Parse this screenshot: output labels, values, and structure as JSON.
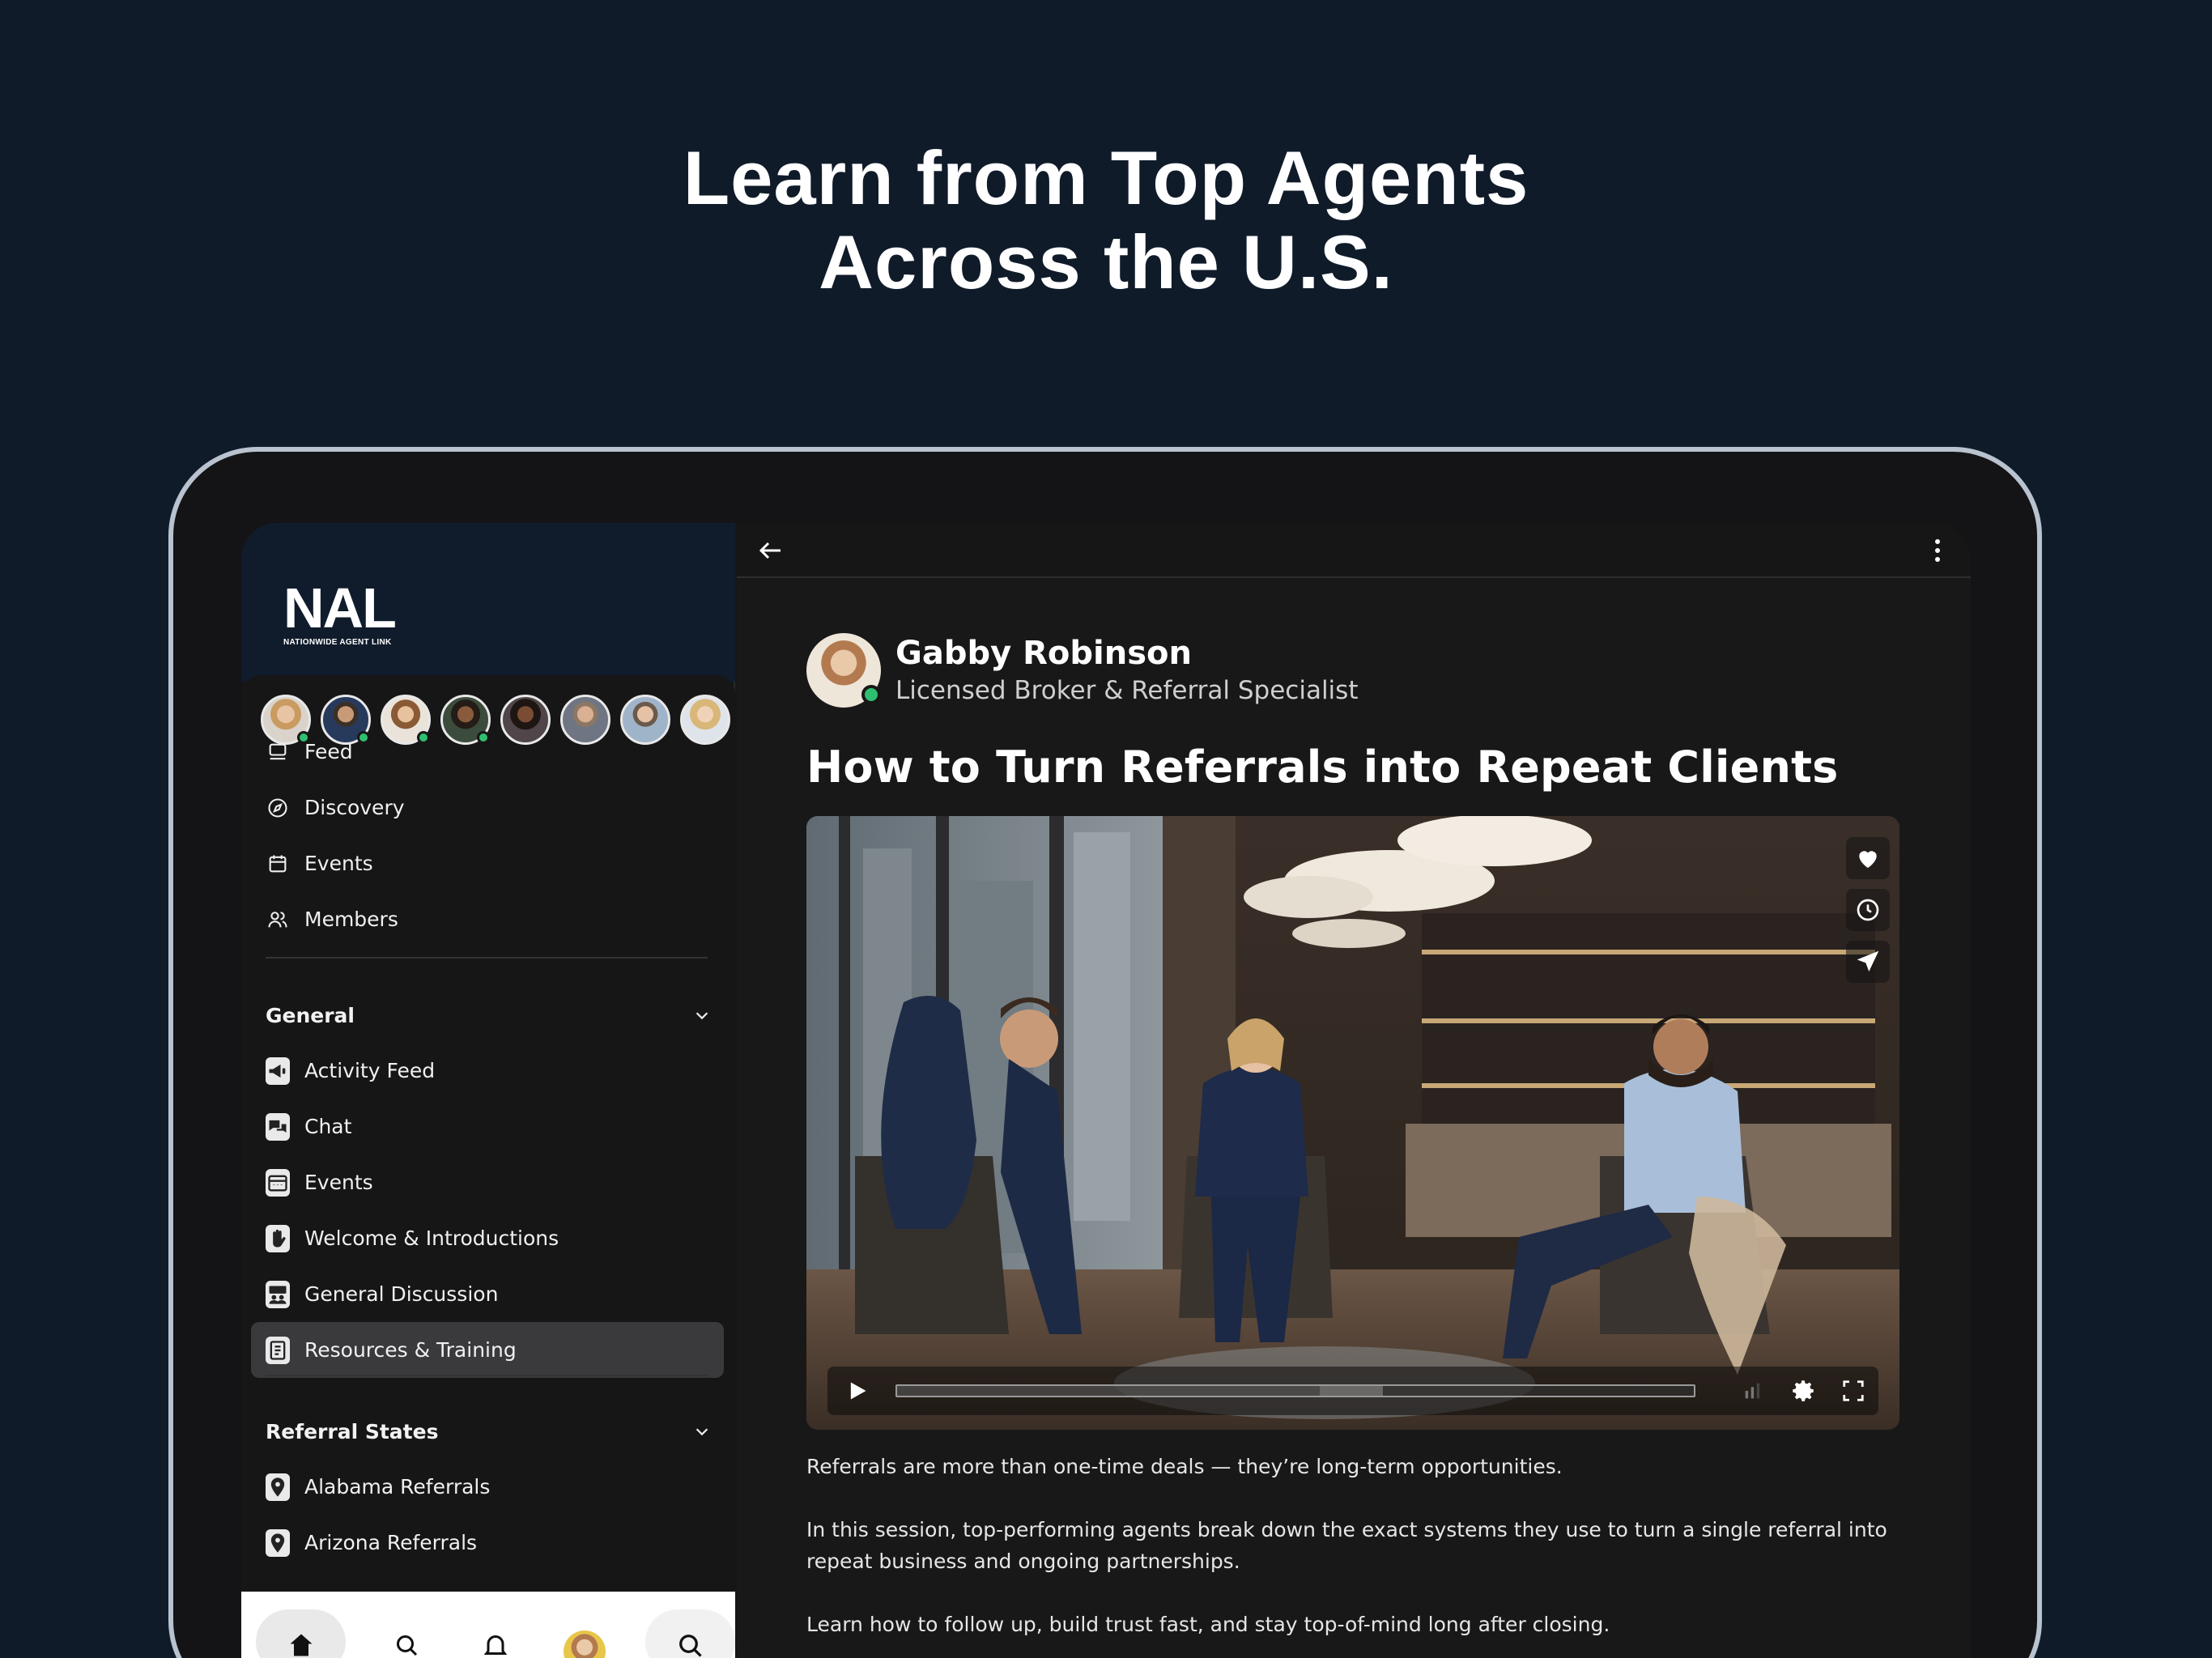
{
  "headline": {
    "line1": "Learn from Top Agents",
    "line2": "Across the U.S."
  },
  "brand": {
    "logo_text": "NAL",
    "logo_sub": "NATIONWIDE AGENT LINK"
  },
  "sidebar": {
    "primary_nav": [
      {
        "label": "Feed",
        "icon": "feed-icon"
      },
      {
        "label": "Discovery",
        "icon": "compass-icon"
      },
      {
        "label": "Events",
        "icon": "calendar-icon"
      },
      {
        "label": "Members",
        "icon": "members-icon"
      }
    ],
    "general": {
      "title": "General",
      "items": [
        {
          "label": "Activity Feed",
          "icon": "megaphone-icon"
        },
        {
          "label": "Chat",
          "icon": "chat-bubbles-icon"
        },
        {
          "label": "Events",
          "icon": "calendar-grid-icon"
        },
        {
          "label": "Welcome & Introductions",
          "icon": "waving-hand-icon"
        },
        {
          "label": "General Discussion",
          "icon": "people-board-icon"
        },
        {
          "label": "Resources & Training",
          "icon": "book-icon",
          "active": true
        }
      ]
    },
    "referral_states": {
      "title": "Referral States",
      "items": [
        {
          "label": "Alabama Referrals",
          "icon": "map-pin-icon"
        },
        {
          "label": "Arizona Referrals",
          "icon": "map-pin-icon"
        }
      ]
    }
  },
  "post": {
    "author_name": "Gabby Robinson",
    "author_role": "Licensed Broker & Referral Specialist",
    "title": "How to Turn Referrals into Repeat Clients",
    "description": [
      "Referrals are more than one-time deals — they’re long-term opportunities.",
      "In this session, top-performing agents break down the exact systems they use to turn a single referral into repeat business and ongoing partnerships.",
      "Learn how to follow up, build trust fast, and stay top-of-mind long after closing."
    ]
  },
  "video": {
    "progress": 0.53,
    "buffered_end": 0.61
  },
  "colors": {
    "page_bg": "#101b2a",
    "online": "#2fbf71",
    "active_item": "#3a3a3d"
  }
}
